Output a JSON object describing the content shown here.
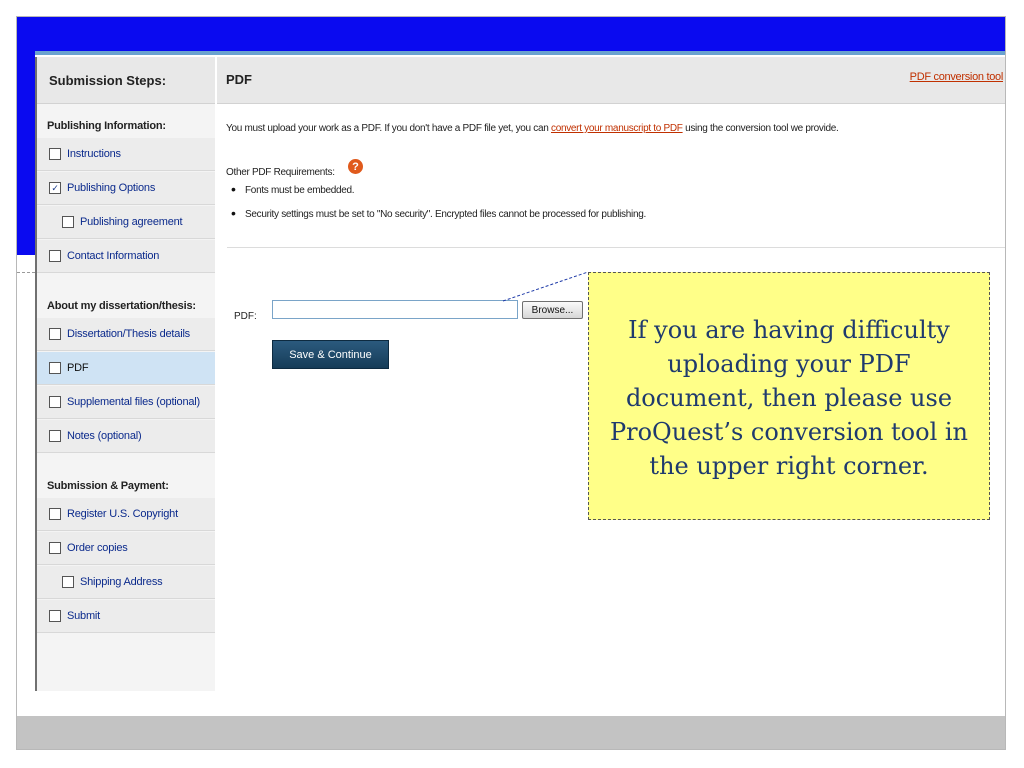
{
  "sidebar": {
    "header": "Submission Steps:",
    "sections": [
      {
        "title": "Publishing Information:",
        "items": [
          {
            "label": "Instructions",
            "checked": false,
            "sub": false,
            "active": false
          },
          {
            "label": "Publishing Options",
            "checked": true,
            "sub": false,
            "active": false
          },
          {
            "label": "Publishing agreement",
            "checked": false,
            "sub": true,
            "active": false
          },
          {
            "label": "Contact Information",
            "checked": false,
            "sub": false,
            "active": false
          }
        ]
      },
      {
        "title": "About my dissertation/thesis:",
        "items": [
          {
            "label": "Dissertation/Thesis details",
            "checked": false,
            "sub": false,
            "active": false
          },
          {
            "label": "PDF",
            "checked": false,
            "sub": false,
            "active": true
          },
          {
            "label": "Supplemental files (optional)",
            "checked": false,
            "sub": false,
            "active": false
          },
          {
            "label": "Notes (optional)",
            "checked": false,
            "sub": false,
            "active": false
          }
        ]
      },
      {
        "title": "Submission & Payment:",
        "items": [
          {
            "label": "Register U.S. Copyright",
            "checked": false,
            "sub": false,
            "active": false
          },
          {
            "label": "Order copies",
            "checked": false,
            "sub": false,
            "active": false
          },
          {
            "label": "Shipping Address",
            "checked": false,
            "sub": true,
            "active": false
          },
          {
            "label": "Submit",
            "checked": false,
            "sub": false,
            "active": false
          }
        ]
      }
    ]
  },
  "main": {
    "title": "PDF",
    "conversion_link": "PDF conversion tool",
    "intro_before": "You must upload your work as a PDF. If you don't have a PDF file yet, you can ",
    "intro_link": "convert your manuscript to PDF",
    "intro_after": " using the conversion tool we provide.",
    "requirements_title": "Other PDF Requirements:",
    "requirements": [
      "Fonts must be embedded.",
      "Security settings must be set to \"No security\". Encrypted files cannot be processed for publishing."
    ],
    "pdf_label": "PDF:",
    "pdf_value": "",
    "browse_label": "Browse...",
    "save_label": "Save & Continue"
  },
  "callout": {
    "text": "If you are having difficulty uploading your PDF document, then please use ProQuest’s conversion tool in the  upper right corner."
  },
  "icons": {
    "help": "question-circle-icon",
    "checkbox": "checkbox-icon",
    "checkmark": "checkmark-icon"
  },
  "colors": {
    "slide_blue": "#0a0af0",
    "link": "#c03000",
    "callout_fill": "#ffff88",
    "callout_text": "#1f3a6e",
    "button": "#1f4a6b"
  }
}
